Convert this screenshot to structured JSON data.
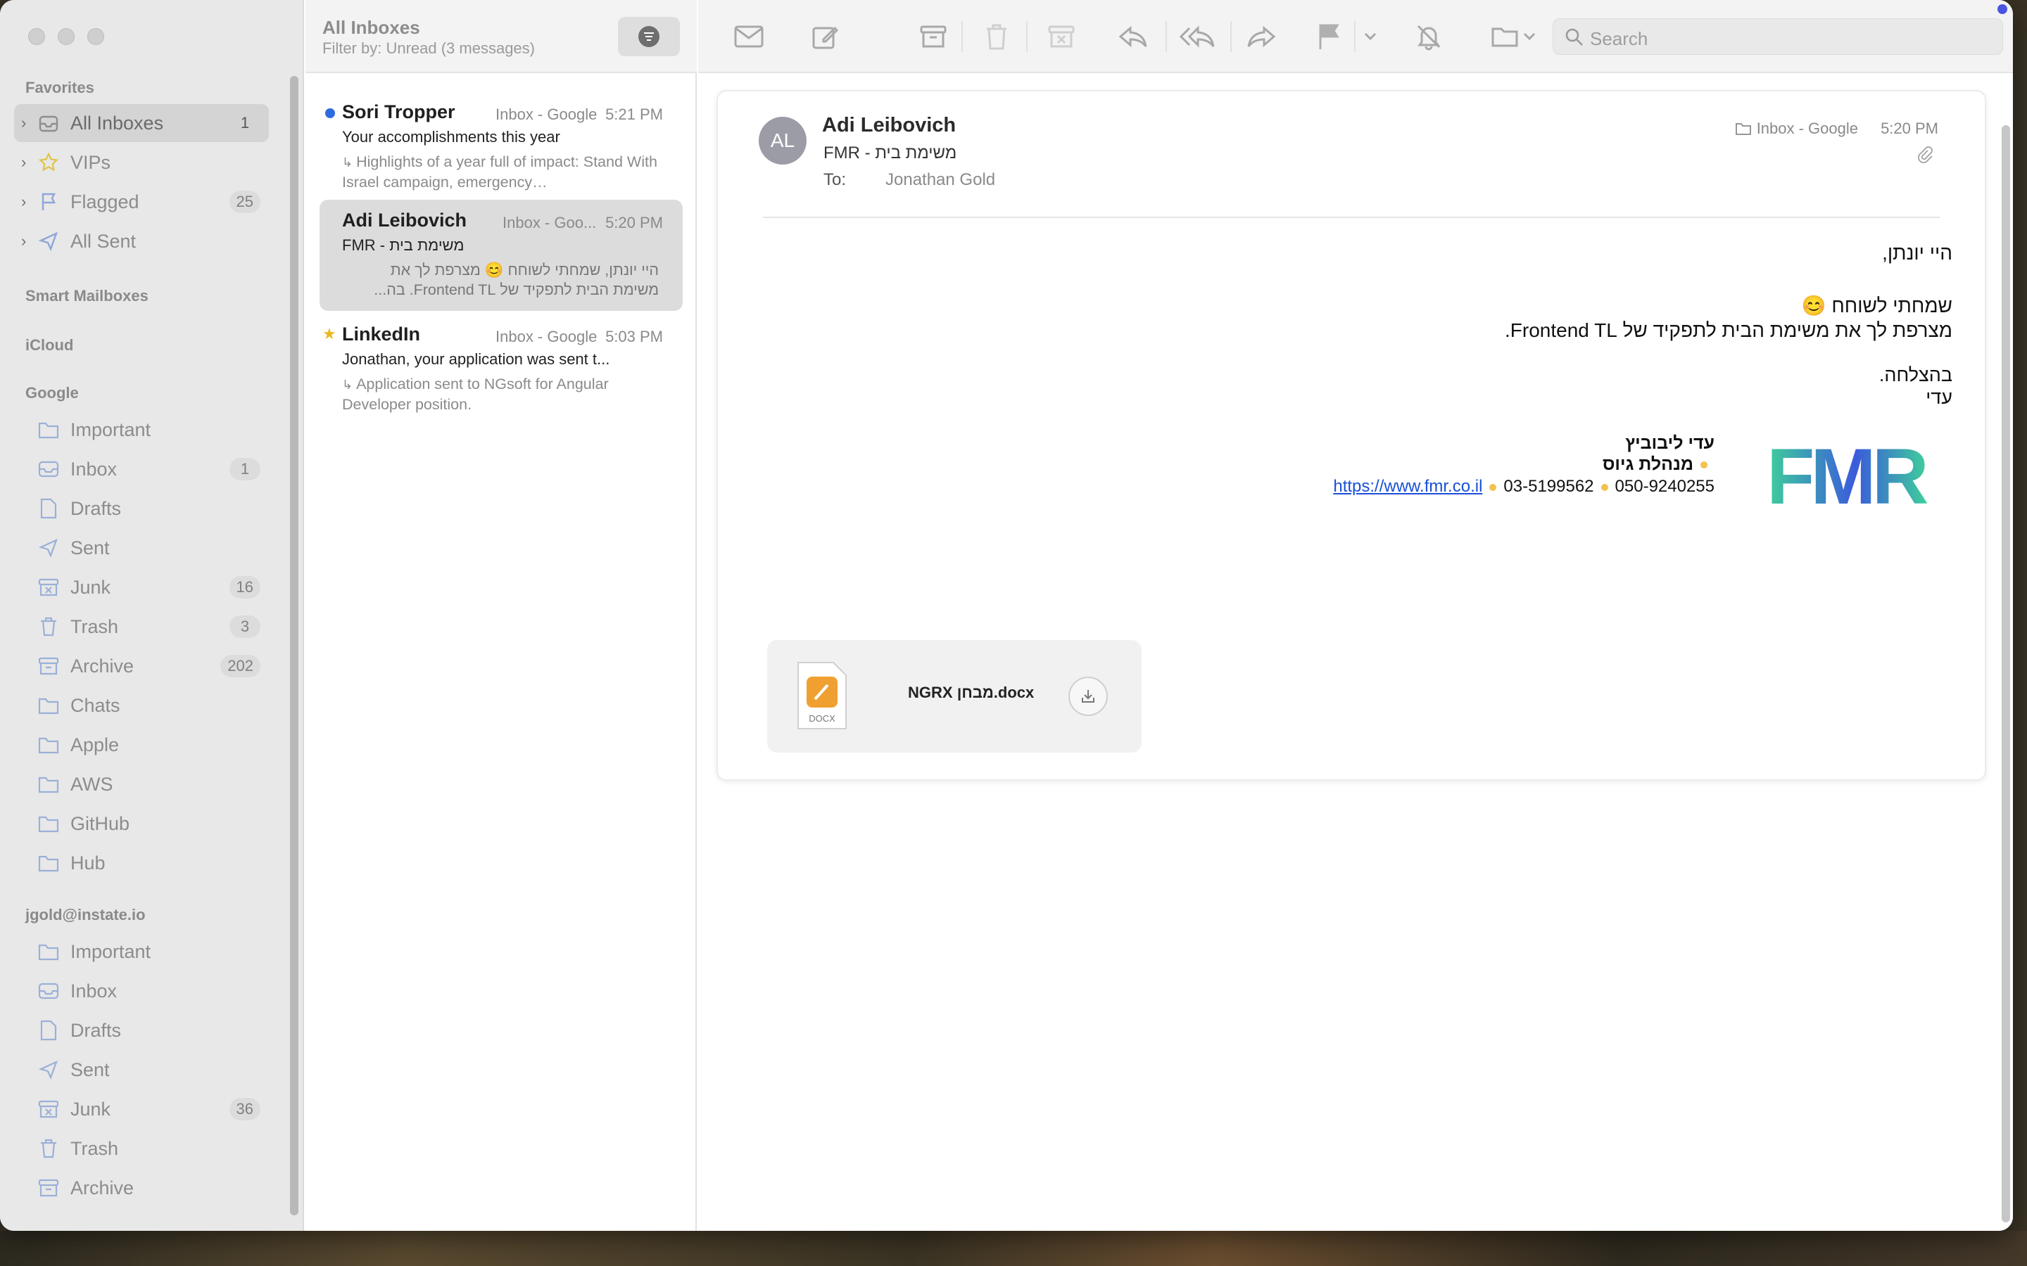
{
  "sidebar": {
    "sections": {
      "favorites": "Favorites",
      "smart": "Smart Mailboxes",
      "icloud": "iCloud",
      "google": "Google",
      "account2": "jgold@instate.io"
    },
    "favorites": [
      {
        "label": "All Inboxes",
        "count": "1"
      },
      {
        "label": "VIPs",
        "count": ""
      },
      {
        "label": "Flagged",
        "count": "25"
      },
      {
        "label": "All Sent",
        "count": ""
      }
    ],
    "google": [
      {
        "label": "Important",
        "count": ""
      },
      {
        "label": "Inbox",
        "count": "1"
      },
      {
        "label": "Drafts",
        "count": ""
      },
      {
        "label": "Sent",
        "count": ""
      },
      {
        "label": "Junk",
        "count": "16"
      },
      {
        "label": "Trash",
        "count": "3"
      },
      {
        "label": "Archive",
        "count": "202"
      },
      {
        "label": "Chats",
        "count": ""
      },
      {
        "label": "Apple",
        "count": ""
      },
      {
        "label": "AWS",
        "count": ""
      },
      {
        "label": "GitHub",
        "count": ""
      },
      {
        "label": "Hub",
        "count": ""
      }
    ],
    "account2": [
      {
        "label": "Important",
        "count": ""
      },
      {
        "label": "Inbox",
        "count": ""
      },
      {
        "label": "Drafts",
        "count": ""
      },
      {
        "label": "Sent",
        "count": ""
      },
      {
        "label": "Junk",
        "count": "36"
      },
      {
        "label": "Trash",
        "count": ""
      },
      {
        "label": "Archive",
        "count": ""
      }
    ]
  },
  "list": {
    "title": "All Inboxes",
    "filter_text": "Filter by: Unread (3 messages)",
    "messages": [
      {
        "sender": "Sori Tropper",
        "mailbox": "Inbox - Google",
        "time": "5:21 PM",
        "subject": "Your accomplishments this year",
        "preview": "Highlights of a year full of impact: Stand With Israel campaign, emergency…"
      },
      {
        "sender": "Adi Leibovich",
        "mailbox": "Inbox - Goo...",
        "time": "5:20 PM",
        "subject": "FMR - משימת בית",
        "preview": "היי יונתן, שמחתי לשוחח 😊 מצרפת לך את משימת הבית לתפקיד של Frontend TL. בה..."
      },
      {
        "sender": "LinkedIn",
        "mailbox": "Inbox - Google",
        "time": "5:03 PM",
        "subject": "Jonathan, your application was sent t...",
        "preview": "Application sent to NGsoft for Angular Developer position."
      }
    ]
  },
  "toolbar": {
    "search_placeholder": "Search"
  },
  "email": {
    "avatar_initials": "AL",
    "from": "Adi Leibovich",
    "subject": "FMR - משימת בית",
    "to_label": "To:",
    "to": "Jonathan Gold",
    "mailbox": "Inbox - Google",
    "time": "5:20 PM",
    "body": {
      "greeting": "היי יונתן,",
      "line1": "שמחתי לשוחח 😊",
      "line2": "מצרפת לך את משימת הבית לתפקיד של Frontend TL.",
      "closing1": "בהצלחה.",
      "closing2": "עדי"
    },
    "signature": {
      "name": "עדי ליבוביץ",
      "title": "מנהלת גיוס",
      "url": "https://www.fmr.co.il",
      "phone1": "03-5199562",
      "phone2": "050-9240255",
      "logo_text": "FMR"
    },
    "attachment": {
      "filename": "NGRX מבחן.docx",
      "type_label": "DOCX"
    }
  },
  "colors": {
    "unread_dot": "#2e6bdc",
    "star": "#e8b820",
    "logo_green": "#3ecf9a",
    "logo_blue": "#3b5bdb",
    "link": "#1a4fd6"
  }
}
